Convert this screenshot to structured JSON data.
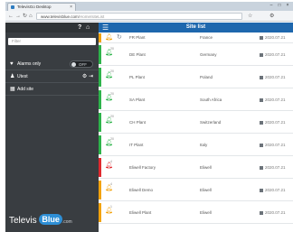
{
  "browser": {
    "tab_title": "TelevisGo Desktop",
    "url_host": "www.televisblue.com",
    "url_rest": "/Home/siteList"
  },
  "sidebar": {
    "filter_placeholder": "Filter",
    "alarms_label": "Alarms only",
    "alarms_toggle": "OFF",
    "user_label": "Utest",
    "add_site_label": "Add site",
    "logo_text": "Televis",
    "logo_badge": "Blue",
    "logo_suffix": ".com"
  },
  "header": {
    "title": "Site list"
  },
  "colors": {
    "header_blue": "#1e67ad",
    "sidebar_dark": "#393d41",
    "ok_green": "#2db34a",
    "alarm_red": "#e0282e",
    "warn_orange": "#f2a20c"
  },
  "sites": [
    {
      "name": "FR Plant",
      "country": "France",
      "date": "2020.07.21",
      "status": "warn",
      "count": ""
    },
    {
      "name": "DE Plant",
      "country": "Germany",
      "date": "2020.07.21",
      "status": "ok",
      "count": "20"
    },
    {
      "name": "PL Plant",
      "country": "Poland",
      "date": "2020.07.21",
      "status": "ok",
      "count": "20"
    },
    {
      "name": "SA Plant",
      "country": "South Africa",
      "date": "2020.07.21",
      "status": "ok",
      "count": "20"
    },
    {
      "name": "CH Plant",
      "country": "Switzerland",
      "date": "2020.07.21",
      "status": "ok",
      "count": "20"
    },
    {
      "name": "IT Plant",
      "country": "Italy",
      "date": "2020.07.21",
      "status": "ok",
      "count": "20"
    },
    {
      "name": "Eliwell Factory",
      "country": "Eliwell",
      "date": "2020.07.21",
      "status": "alarm",
      "count": "4"
    },
    {
      "name": "Eliwell Demo",
      "country": "Eliwell",
      "date": "2020.07.21",
      "status": "warn",
      "count": "4"
    },
    {
      "name": "Eliwell Plant",
      "country": "Eliwell",
      "date": "2020.07.21",
      "status": "warn",
      "count": "1"
    }
  ]
}
